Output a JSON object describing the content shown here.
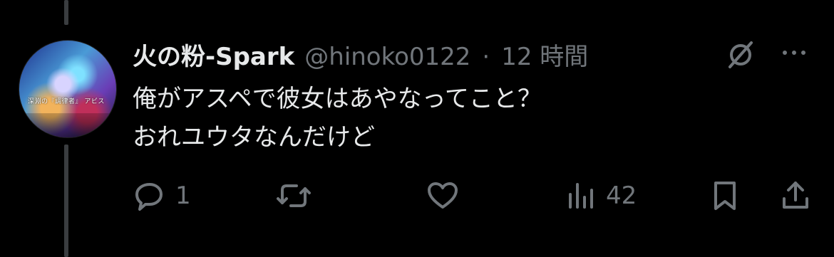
{
  "tweet": {
    "display_name": "火の粉-Spark",
    "handle": "@hinoko0122",
    "separator": "·",
    "time": "12 時間",
    "text": "俺がアスペで彼女はあやなってこと？\nおれユウタなんだけど"
  },
  "avatar": {
    "caption": "深淵の『調律者』 アビス"
  },
  "actions": {
    "replies": "1",
    "retweets": "",
    "likes": "",
    "views": "42"
  },
  "icons": {
    "reply": "reply-icon",
    "retweet": "retweet-icon",
    "like": "heart-icon",
    "views": "views-icon",
    "bookmark": "bookmark-icon",
    "share": "share-icon",
    "grok": "grok-icon",
    "more": "more-icon"
  },
  "colors": {
    "background": "#000000",
    "text_primary": "#e7e9ea",
    "text_secondary": "#71767b",
    "thread_line": "#3a3d40"
  }
}
